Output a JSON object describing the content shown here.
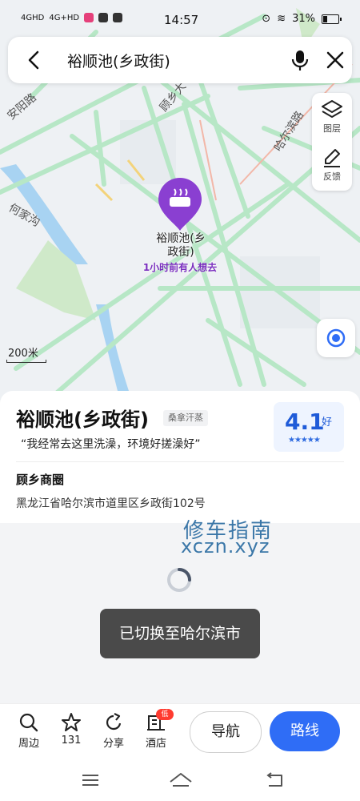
{
  "status_bar": {
    "signal_1": "4GHD",
    "signal_2": "4G+HD",
    "time": "14:57",
    "battery": "31%"
  },
  "search": {
    "query": "裕顺池(乡政街)"
  },
  "map": {
    "controls": {
      "layers_label": "图层",
      "feedback_label": "反馈"
    },
    "poi_name": "裕顺池(乡\n政街)",
    "poi_subtitle": "1小时前有人想去",
    "scale_label": "200米",
    "road_labels": [
      "安阳路",
      "何家沟",
      "顾乡大",
      "哈尔滨路"
    ],
    "colors": {
      "road": "#b8e8c8",
      "poi": "#8a3fd1"
    }
  },
  "place_card": {
    "name": "裕顺池(乡政街)",
    "category_tag": "桑拿汗蒸",
    "quote": "“我经常去这里洗澡，环境好搓澡好”",
    "rating_score": "4.1",
    "rating_word": "好",
    "rating_stars": "★★★★★",
    "business_area": "顾乡商圈",
    "address": "黑龙江省哈尔滨市道里区乡政街102号"
  },
  "watermark": {
    "line1": "修车指南",
    "line2": "xczn.xyz"
  },
  "toast": {
    "message": "已切换至哈尔滨市"
  },
  "bottom_bar": {
    "nearby_label": "周边",
    "favorite_count": "131",
    "share_label": "分享",
    "hotel_label": "酒店",
    "hotel_badge": "低价",
    "navigate_label": "导航",
    "route_label": "路线",
    "colors": {
      "primary": "#2f6df6"
    }
  }
}
